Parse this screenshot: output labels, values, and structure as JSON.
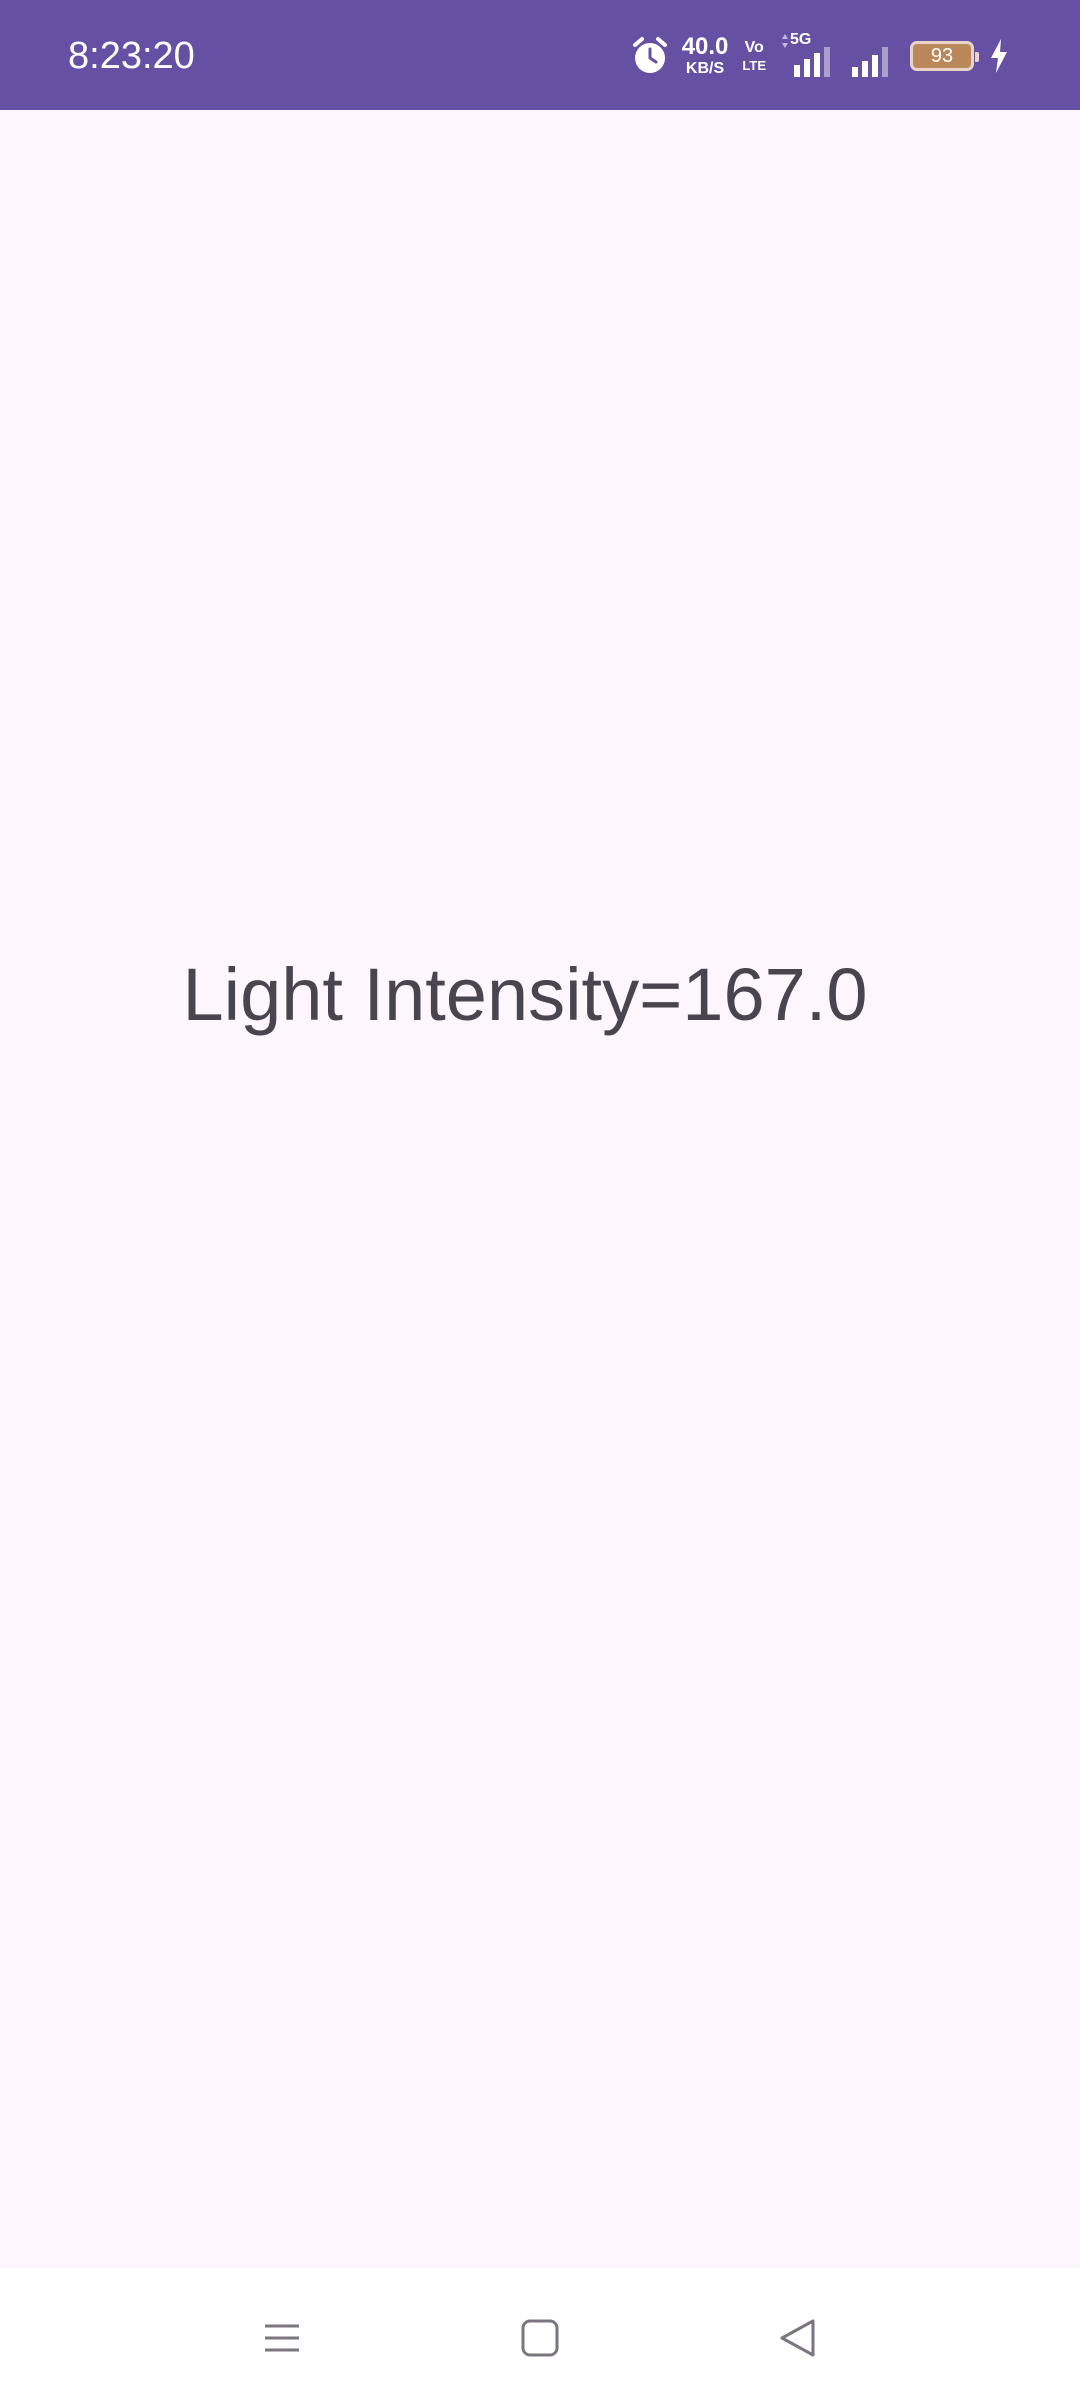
{
  "status_bar": {
    "time": "8:23:20",
    "net_speed_value": "40.0",
    "net_speed_unit": "KB/S",
    "volte_top": "Vo",
    "volte_bottom": "LTE",
    "network_label": "5G",
    "battery_level": "93",
    "icons": [
      "alarm-icon",
      "signal-icon",
      "signal-icon",
      "battery-icon",
      "charging-icon"
    ]
  },
  "main": {
    "light_intensity_text": "Light Intensity=167.0"
  },
  "nav_bar": {
    "icons": [
      "menu-icon",
      "home-icon",
      "back-icon"
    ]
  },
  "colors": {
    "status_bar_bg": "#6650a4",
    "page_bg": "#fdf7fd",
    "text": "#49454f",
    "nav_icon": "#7a757f"
  }
}
